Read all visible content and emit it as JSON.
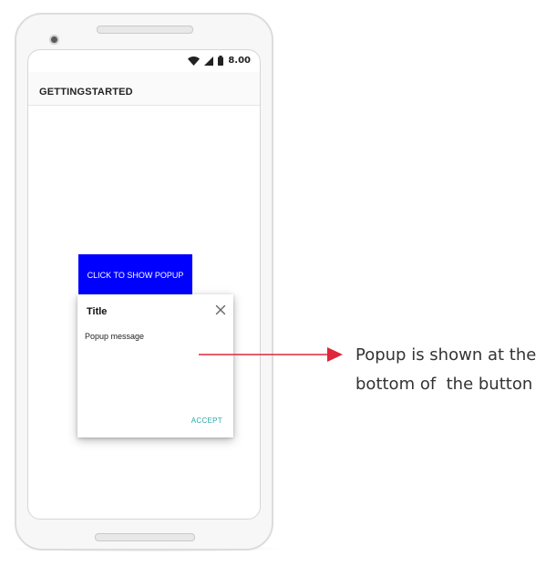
{
  "status_bar": {
    "time": "8.00",
    "icons": [
      "wifi-icon",
      "signal-icon",
      "battery-icon"
    ]
  },
  "app_bar": {
    "title": "GETTINGSTARTED"
  },
  "main": {
    "show_popup_button": "CLICK TO SHOW POPUP",
    "button_color": "#0000ff"
  },
  "popup": {
    "title": "Title",
    "message": "Popup message",
    "accept": "ACCEPT",
    "close_icon": "close-icon",
    "accent_color": "#2aa8a8"
  },
  "annotation": {
    "line1": "Popup is shown at the",
    "line2": "bottom of  the button",
    "arrow_color": "#e0263a"
  }
}
